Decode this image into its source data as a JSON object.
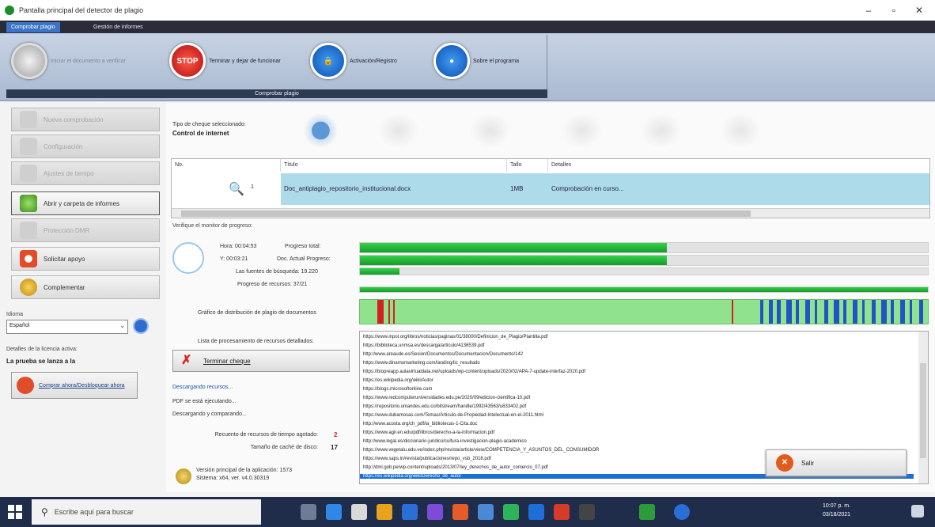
{
  "window": {
    "title": "Pantalla principal del detector de plagio"
  },
  "tabs": [
    {
      "label": "Comprobar plagio"
    },
    {
      "label": "Gestión de informes"
    }
  ],
  "ribbon": {
    "group_title": "Comprobar plagio",
    "buttons": [
      {
        "label": "Iniciar el documento a verificar",
        "icon": "globe-icon",
        "disabled": true
      },
      {
        "label": "Terminar y dejar de funcionar",
        "icon": "stop-sign-icon",
        "badge": "STOP"
      },
      {
        "label": "Activación/Registro",
        "icon": "lock-icon"
      },
      {
        "label": "Sobre el programa",
        "icon": "camera-icon"
      }
    ]
  },
  "sidebar": {
    "items": [
      {
        "label": "Nueva comprobación",
        "state": "disabled"
      },
      {
        "label": "Configuración",
        "state": "disabled"
      },
      {
        "label": "Ajustes de tiempo",
        "state": "disabled"
      },
      {
        "label": "Abrir y carpeta de informes",
        "state": "selected"
      },
      {
        "label": "Protección DMR",
        "state": "disabled"
      },
      {
        "label": "Solicitar apoyo",
        "state": "normal"
      },
      {
        "label": "Complementar",
        "state": "normal"
      }
    ],
    "language_label": "Idioma",
    "language_value": "Español",
    "license_label": "Detalles de la licencia activa:",
    "license_value": "La prueba se lanza a la",
    "buy_label": "Comprar ahora/Desbloquear ahora"
  },
  "check_type": {
    "label": "Tipo de cheque seleccionado:",
    "value": "Control de internet",
    "icons": [
      "internet-check-icon",
      "database-check-icon",
      "web-db-check-icon",
      "files-check-icon",
      "document-check-icon",
      "archive-check-icon"
    ]
  },
  "table": {
    "headers": [
      "No.",
      "Título",
      "Tallo",
      "Detalles"
    ],
    "rows": [
      {
        "no": "1",
        "title": "Doc_antiplagio_repositorio_institucional.docx",
        "size": "1MB",
        "details": "Comprobación en curso..."
      }
    ]
  },
  "progress": {
    "title": "Verifique el monitor de progreso:",
    "time_label_1": "Hora: 00:04:53",
    "time_label_2": "Y: 00:03:21",
    "labels": [
      "Progreso total:",
      "Doc. Actual Progreso:",
      "Las fuentes de búsqueda: 19.220",
      "Progreso de recursos: 37/21"
    ],
    "values": [
      0.54,
      0.54,
      0.07,
      1.0
    ],
    "distribution_label": "Gráfico de distribución de plagio de documentos",
    "sources_label": "Lista de procesamiento de recursos detallados:"
  },
  "urls": [
    "https://www.inpol.org/libros/noticias/paginas/01/38000/Definicion_de_Plagio/Plantilla.pdf",
    "https://biblioteca.unmsa.es/descarga/articulo/4136539.pdf",
    "http://www.areaude.es/Sesion/Documentos/Documentacion/Documento/142",
    "https://www.dinamomarketing.com/landing/lic_resultado",
    "https://biopreapp.aulavirtualdata.net/uploads/wp-content/uploads/2020/02/APA-7-update-interfaz-2020.pdf",
    "https://es.wikipedia.org/wiki/Autor",
    "https://blogs.microsoftonline.com",
    "https://www.redcomputeruniversidades.edu.pe/2020/09/edicion-cientifica-10.pdf",
    "https://repositorio.uniandes.edu.co/bitstream/handle/1992/43563/u833402.pdf",
    "https://www.dubamosas.com/Temas/Articulo-de-Propiedad-Intelectual-en-el-2011.html",
    "http://www.acosta.org/ch_pdf/ia_bibliotecas-1-Cita.doc",
    "https://www.agil.en.edu/pdf/libros/derecho-a-la-informacion.pdf",
    "http://www.legal.es/diccionario-juridico/cultura-investigacion-plagio-academico",
    "https://www.vegetalu.edu.ve/index.php/revista/article/view/COMPETENCIA_Y_ASUNTOS_DEL_CONSUMIDOR",
    "https://www.saps.in/revista/publicaciones/repo_vsb_2018.pdf",
    "http://dml.gob.pe/wp-content/uploads/2013/07/ley_derechos_de_autor_comercio_07.pdf",
    "https://es.wikipedia.org/wiki/Derecho_de_autor"
  ],
  "controls": {
    "stop_label": "Terminar cheque",
    "exit_label": "Salir"
  },
  "status": {
    "link": "Descargando recursos...",
    "line2": "PDF se está ejecutando...",
    "line3": "Descargando y comparando..."
  },
  "stats": [
    {
      "label": "Recuento de recursos de tiempo agotado:",
      "value": "2",
      "color": "#d22020"
    },
    {
      "label": "Tamaño de caché de disco:",
      "value": "17",
      "color": "#222222"
    }
  ],
  "version": {
    "line1": "Versión principal de la aplicación: 1573",
    "line2": "Sistema: x64, ver. v4.0.30319"
  },
  "taskbar": {
    "search_placeholder": "Escribe aquí para buscar",
    "time": "10:07 p. m.",
    "date": "03/18/2021"
  },
  "colors": {
    "accent": "#3b73c7",
    "progress": "#1fbf35",
    "selected_row": "#aedbe9",
    "match_red": "#d42020",
    "match_blue": "#2254c8"
  }
}
